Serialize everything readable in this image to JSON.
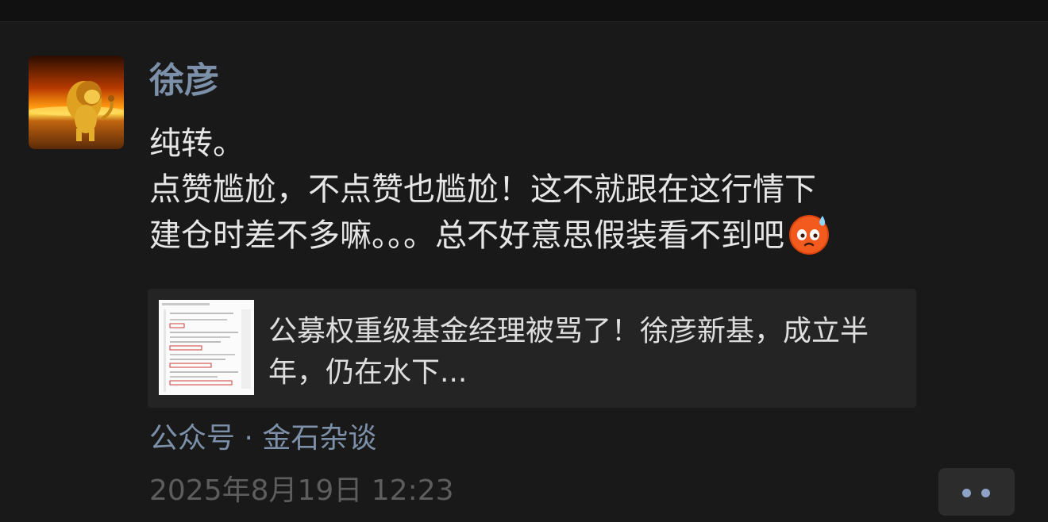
{
  "post": {
    "author_name": "徐彦",
    "content_lines": [
      "纯转。",
      "点赞尴尬，不点赞也尴尬！这不就跟在这行情下",
      "建仓时差不多嘛。。。总不好意思假装看不到吧"
    ],
    "content_emoji": "awkward-sweat-emoji",
    "shared_article": {
      "title": "公募权重级基金经理被骂了！徐彦新基，成立半年，仍在水下..."
    },
    "source": "公众号 · 金石杂谈",
    "timestamp": "2025年8月19日 12:23",
    "more_icon": "more-dots-icon"
  },
  "colors": {
    "background": "#191919",
    "name_link": "#7d90a9",
    "text": "#e6e6e6",
    "card": "#242424",
    "timestamp": "#5d5d5d",
    "more_dots": "#8da2c4"
  }
}
